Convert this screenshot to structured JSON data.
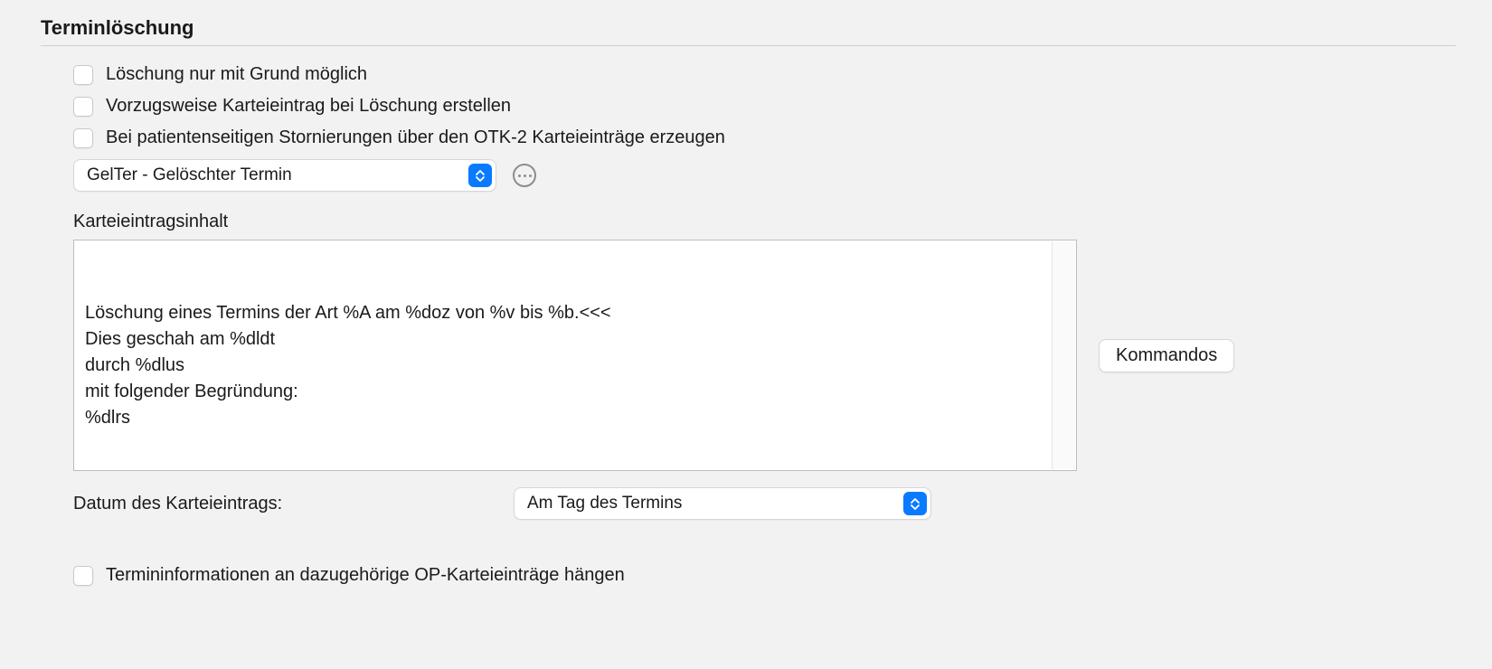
{
  "section": {
    "title": "Terminlöschung"
  },
  "checkboxes": {
    "reason_required": "Löschung nur mit Grund möglich",
    "prefer_entry": "Vorzugsweise Karteieintrag bei Löschung erstellen",
    "otk2_entries": "Bei patientenseitigen Stornierungen über den OTK-2 Karteieinträge erzeugen",
    "op_append": "Termininformationen an dazugehörige OP-Karteieinträge hängen"
  },
  "type_select": {
    "value": "GelTer - Gelöschter Termin"
  },
  "content": {
    "label": "Karteieintragsinhalt",
    "text": "Löschung eines Termins der Art %A am %doz von %v bis %b.<<<\nDies geschah am %dldt\ndurch %dlus\nmit folgender Begründung:\n%dlrs"
  },
  "commands_button": "Kommandos",
  "date_row": {
    "label": "Datum des Karteieintrags:",
    "value": "Am Tag des Termins"
  }
}
